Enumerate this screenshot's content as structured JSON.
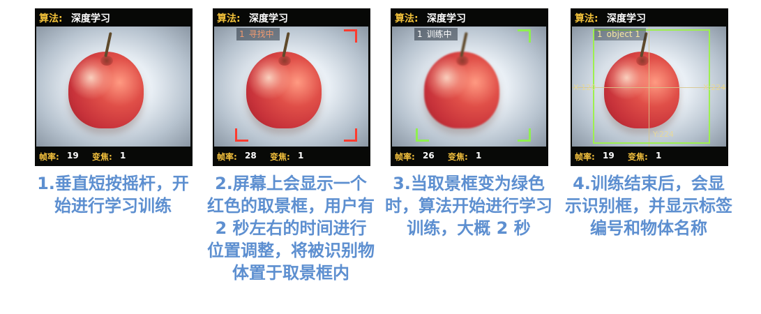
{
  "steps": [
    {
      "screen": {
        "algo_label": "算法:",
        "algo_value": "深度学习",
        "fps_label": "帧率:",
        "fps_value": "19",
        "zoom_label": "变焦:",
        "zoom_value": "1"
      },
      "caption": "1.垂直短按摇杆，开始进行学习训练"
    },
    {
      "screen": {
        "algo_label": "算法:",
        "algo_value": "深度学习",
        "status_num": "1",
        "status_text": "寻找中",
        "fps_label": "帧率:",
        "fps_value": "28",
        "zoom_label": "变焦:",
        "zoom_value": "1",
        "frame_color": "#ff3b2e"
      },
      "caption": "2.屏幕上会显示一个红色的取景框，用户有 2 秒左右的时间进行位置调整，将被识别物体置于取景框内"
    },
    {
      "screen": {
        "algo_label": "算法:",
        "algo_value": "深度学习",
        "status_num": "1",
        "status_text": "训练中",
        "fps_label": "帧率:",
        "fps_value": "26",
        "zoom_label": "变焦:",
        "zoom_value": "1",
        "frame_color": "#8ff04f"
      },
      "caption": "3.当取景框变为绿色时，算法开始进行学习训练，大概 2 秒"
    },
    {
      "screen": {
        "algo_label": "算法:",
        "algo_value": "深度学习",
        "status_num": "1",
        "status_text": "object 1",
        "coord_left": "X:120",
        "coord_right": "X:224",
        "coord_bottom": "Y:224",
        "fps_label": "帧率:",
        "fps_value": "19",
        "zoom_label": "变焦:",
        "zoom_value": "1",
        "frame_color": "#9df04e"
      },
      "caption": "4.训练结束后，会显示识别框，并显示标签编号和物体名称"
    }
  ]
}
